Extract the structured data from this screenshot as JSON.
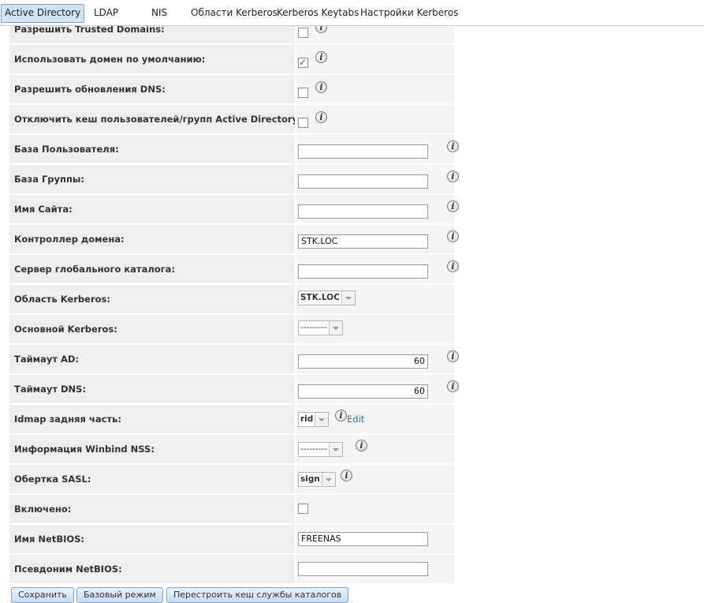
{
  "tabs": [
    {
      "label": "Active Directory",
      "active": true
    },
    {
      "label": "LDAP"
    },
    {
      "label": "NIS"
    },
    {
      "label": "Области Kerberos"
    },
    {
      "label": "Kerberos Keytabs"
    },
    {
      "label": "Настройки Kerberos"
    }
  ],
  "form": {
    "allow_trusted_domains": {
      "label": "Разрешить Trusted Domains:",
      "checked": false
    },
    "use_default_domain": {
      "label": "Использовать домен по умолчанию:",
      "checked": true,
      "mark": "✓"
    },
    "allow_dns_updates": {
      "label": "Разрешить обновления DNS:",
      "checked": false
    },
    "disable_cache": {
      "label": "Отключить кеш пользователей/групп Active Directory:",
      "checked": false
    },
    "user_base": {
      "label": "База Пользователя:",
      "value": ""
    },
    "group_base": {
      "label": "База Группы:",
      "value": ""
    },
    "site_name": {
      "label": "Имя Сайта:",
      "value": ""
    },
    "domain_controller": {
      "label": "Контроллер домена:",
      "value": "STK.LOC"
    },
    "global_catalog": {
      "label": "Сервер глобального каталога:",
      "value": ""
    },
    "kerberos_realm": {
      "label": "Область Kerberos:",
      "selected": "STK.LOC"
    },
    "kerberos_principal": {
      "label": "Основной Kerberos:",
      "selected": "---------"
    },
    "ad_timeout": {
      "label": "Таймаут AD:",
      "value": "60"
    },
    "dns_timeout": {
      "label": "Таймаут DNS:",
      "value": "60"
    },
    "idmap_backend": {
      "label": "Idmap задняя часть:",
      "selected": "rid",
      "edit_label": "Edit"
    },
    "winbind_nss": {
      "label": "Информация Winbind NSS:",
      "selected": "---------"
    },
    "sasl_wrapping": {
      "label": "Обертка SASL:",
      "selected": "sign"
    },
    "enabled": {
      "label": "Включено:",
      "checked": false
    },
    "netbios_name": {
      "label": "Имя NetBIOS:",
      "value": "FREENAS"
    },
    "netbios_alias": {
      "label": "Псевдоним NetBIOS:",
      "value": ""
    }
  },
  "info_icon_glyph": "i",
  "buttons": {
    "save": "Сохранить",
    "basic_mode": "Базовый режим",
    "rebuild_cache": "Перестроить кеш службы каталогов"
  }
}
